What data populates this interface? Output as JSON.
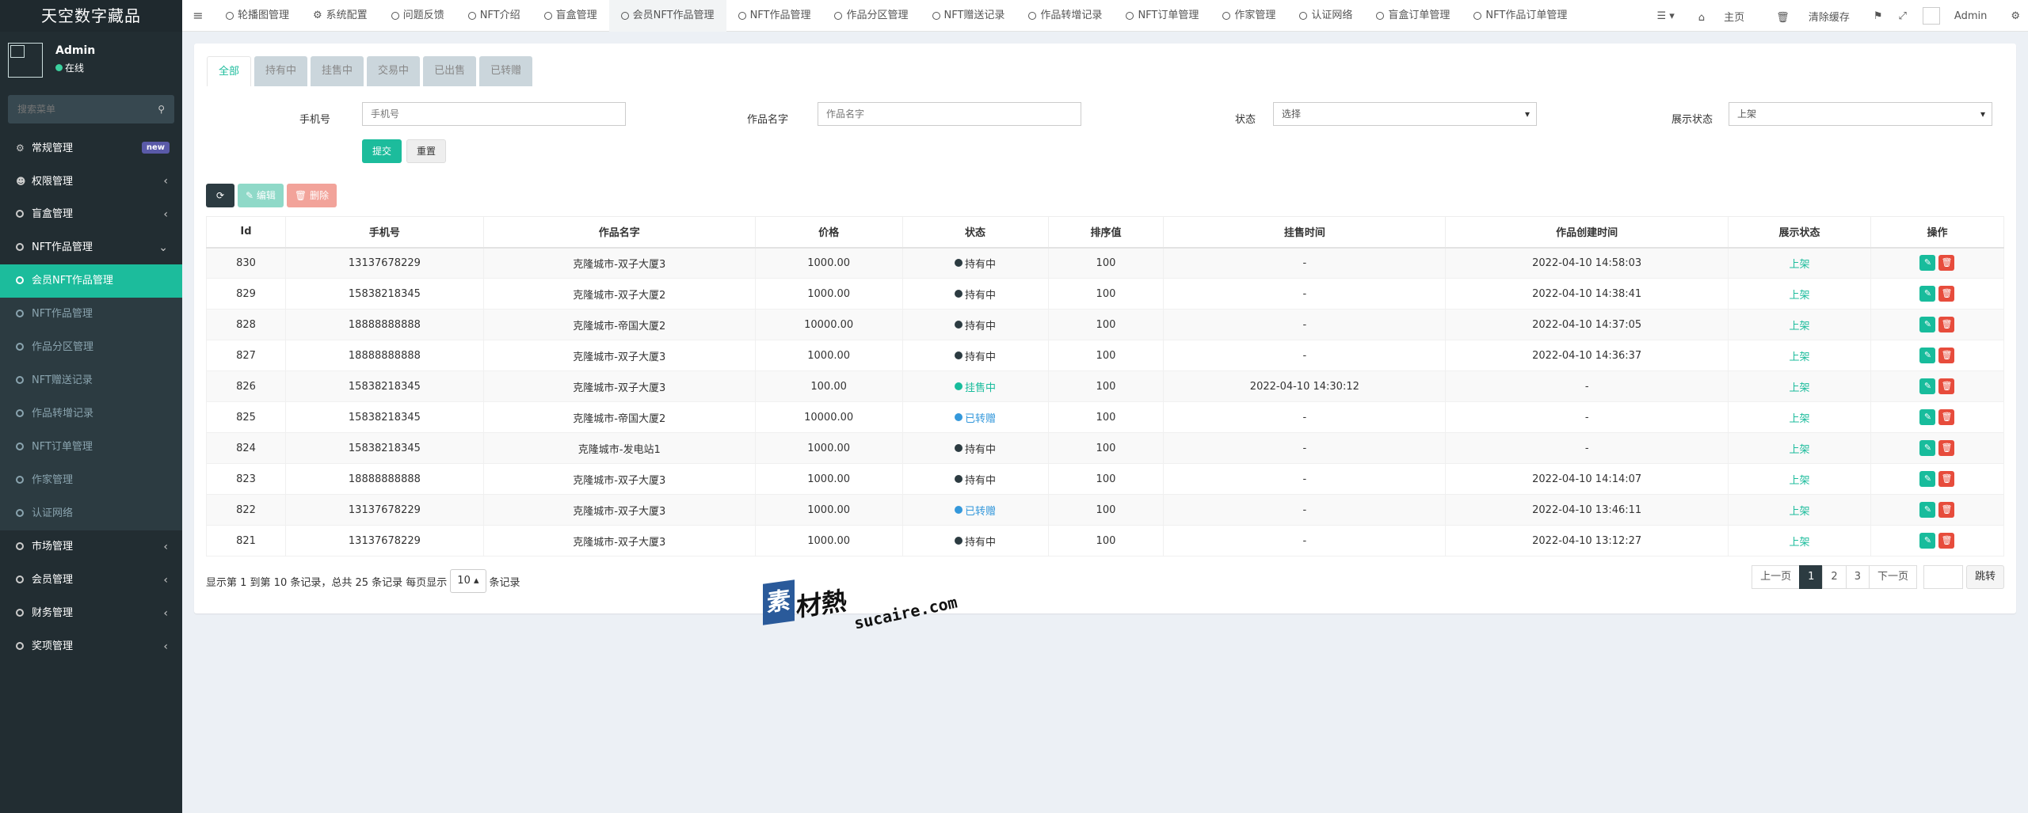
{
  "brand": "天空数字藏品",
  "user": {
    "name": "Admin",
    "status": "在线"
  },
  "sidebar_search": {
    "placeholder": "搜索菜单"
  },
  "menu": [
    {
      "label": "常规管理",
      "badge": "new"
    },
    {
      "label": "权限管理"
    },
    {
      "label": "盲盒管理"
    },
    {
      "label": "NFT作品管理"
    },
    {
      "label": "会员NFT作品管理"
    },
    {
      "label": "NFT作品管理"
    },
    {
      "label": "作品分区管理"
    },
    {
      "label": "NFT赠送记录"
    },
    {
      "label": "作品转增记录"
    },
    {
      "label": "NFT订单管理"
    },
    {
      "label": "作家管理"
    },
    {
      "label": "认证网络"
    },
    {
      "label": "市场管理"
    },
    {
      "label": "会员管理"
    },
    {
      "label": "财务管理"
    },
    {
      "label": "奖项管理"
    }
  ],
  "top_tabs": [
    "轮播图管理",
    "系统配置",
    "问题反馈",
    "NFT介绍",
    "盲盒管理",
    "会员NFT作品管理",
    "NFT作品管理",
    "作品分区管理",
    "NFT赠送记录",
    "作品转增记录",
    "NFT订单管理",
    "作家管理",
    "认证网络",
    "盲盒订单管理",
    "NFT作品订单管理"
  ],
  "top_right": {
    "home": "主页",
    "clear_cache": "清除缓存",
    "admin": "Admin"
  },
  "status_tabs": [
    "全部",
    "持有中",
    "挂售中",
    "交易中",
    "已出售",
    "已转赠"
  ],
  "filters": {
    "phone_label": "手机号",
    "phone_placeholder": "手机号",
    "name_label": "作品名字",
    "name_placeholder": "作品名字",
    "status_label": "状态",
    "status_value": "选择",
    "show_label": "展示状态",
    "show_value": "上架",
    "submit": "提交",
    "reset": "重置"
  },
  "toolbar": {
    "edit": "编辑",
    "delete": "删除"
  },
  "columns": [
    "Id",
    "手机号",
    "作品名字",
    "价格",
    "状态",
    "排序值",
    "挂售时间",
    "作品创建时间",
    "展示状态",
    "操作"
  ],
  "rows": [
    {
      "id": "830",
      "phone": "13137678229",
      "name": "克隆城市-双子大厦3",
      "price": "1000.00",
      "status": "持有中",
      "sort": "100",
      "list_time": "-",
      "created": "2022-04-10 14:58:03",
      "show": "上架"
    },
    {
      "id": "829",
      "phone": "15838218345",
      "name": "克隆城市-双子大厦2",
      "price": "1000.00",
      "status": "持有中",
      "sort": "100",
      "list_time": "-",
      "created": "2022-04-10 14:38:41",
      "show": "上架"
    },
    {
      "id": "828",
      "phone": "18888888888",
      "name": "克隆城市-帝国大厦2",
      "price": "10000.00",
      "status": "持有中",
      "sort": "100",
      "list_time": "-",
      "created": "2022-04-10 14:37:05",
      "show": "上架"
    },
    {
      "id": "827",
      "phone": "18888888888",
      "name": "克隆城市-双子大厦3",
      "price": "1000.00",
      "status": "持有中",
      "sort": "100",
      "list_time": "-",
      "created": "2022-04-10 14:36:37",
      "show": "上架"
    },
    {
      "id": "826",
      "phone": "15838218345",
      "name": "克隆城市-双子大厦3",
      "price": "100.00",
      "status": "挂售中",
      "sort": "100",
      "list_time": "2022-04-10 14:30:12",
      "created": "-",
      "show": "上架"
    },
    {
      "id": "825",
      "phone": "15838218345",
      "name": "克隆城市-帝国大厦2",
      "price": "10000.00",
      "status": "已转赠",
      "sort": "100",
      "list_time": "-",
      "created": "-",
      "show": "上架"
    },
    {
      "id": "824",
      "phone": "15838218345",
      "name": "克隆城市-发电站1",
      "price": "1000.00",
      "status": "持有中",
      "sort": "100",
      "list_time": "-",
      "created": "-",
      "show": "上架"
    },
    {
      "id": "823",
      "phone": "18888888888",
      "name": "克隆城市-双子大厦3",
      "price": "1000.00",
      "status": "持有中",
      "sort": "100",
      "list_time": "-",
      "created": "2022-04-10 14:14:07",
      "show": "上架"
    },
    {
      "id": "822",
      "phone": "13137678229",
      "name": "克隆城市-双子大厦3",
      "price": "1000.00",
      "status": "已转赠",
      "sort": "100",
      "list_time": "-",
      "created": "2022-04-10 13:46:11",
      "show": "上架"
    },
    {
      "id": "821",
      "phone": "13137678229",
      "name": "克隆城市-双子大厦3",
      "price": "1000.00",
      "status": "持有中",
      "sort": "100",
      "list_time": "-",
      "created": "2022-04-10 13:12:27",
      "show": "上架"
    }
  ],
  "status_colors": {
    "持有中": "#2c3b41",
    "挂售中": "#18bc9c",
    "已转赠": "#3498db"
  },
  "pager": {
    "info_prefix": "显示第 1 到第 10 条记录，总共 25 条记录 每页显示",
    "page_size": "10",
    "info_suffix": "条记录",
    "prev": "上一页",
    "pages": [
      "1",
      "2",
      "3"
    ],
    "next": "下一页",
    "jump": "跳转"
  },
  "watermark": {
    "box": "素",
    "cn": "材熱",
    "en": "sucaire.com"
  }
}
